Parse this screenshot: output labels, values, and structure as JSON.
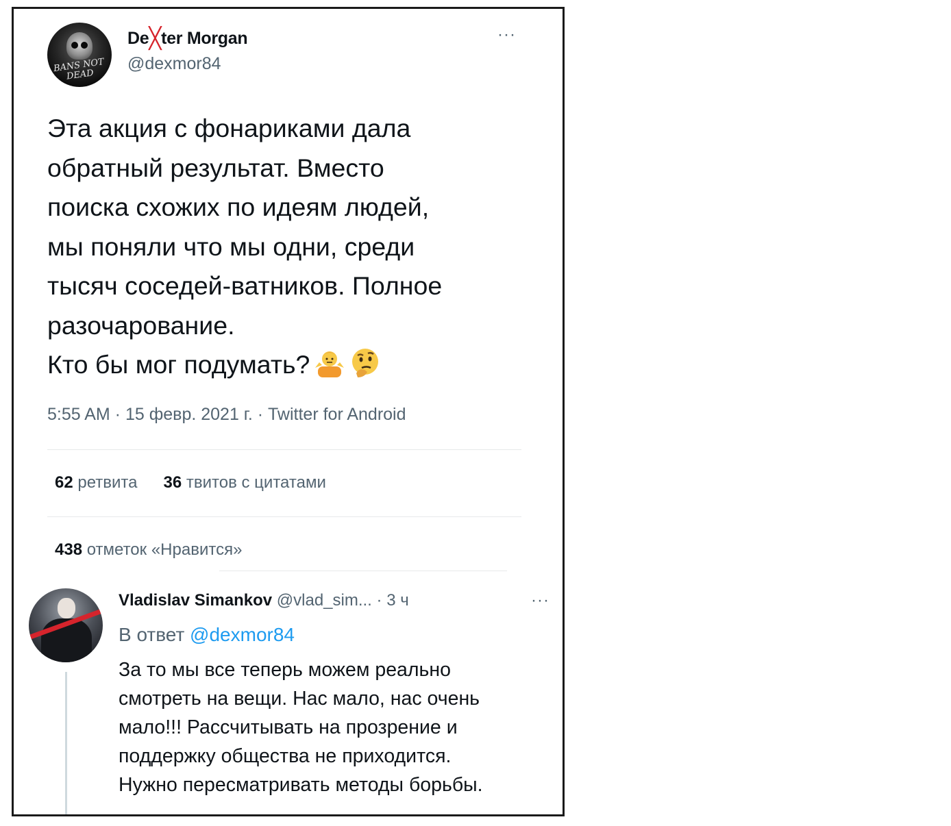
{
  "tweet": {
    "author_name_pre": "De",
    "author_name_x": "╳",
    "author_name_post": "ter Morgan",
    "author_handle": "@dexmor84",
    "more_label": "···",
    "avatar_text": "BANS NOT DEAD",
    "text": "Эта акция с фонариками дала\nобратный результат. Вместо\nпоиска схожих по идеям людей,\nмы поняли что мы одни, среди\nтысяч соседей-ватников. Полное\nразочарование.\nКто бы мог подумать?",
    "emojis": [
      "shrug-emoji",
      "thinking-face-emoji"
    ],
    "meta": "5:55 AM · 15 февр. 2021 г. · Twitter for Android",
    "retweets_count": "62",
    "retweets_label": "ретвита",
    "quotes_count": "36",
    "quotes_label": "твитов с цитатами",
    "likes_count": "438",
    "likes_label": "отметок «Нравится»"
  },
  "reply": {
    "author_name": "Vladislav Simankov",
    "author_handle": "@vlad_sim...",
    "time": " · 3 ч",
    "more_label": "···",
    "reply_to_prefix": "В ответ ",
    "reply_to_mention": "@dexmor84",
    "text": "За то мы все теперь можем реально\nсмотреть на вещи. Нас мало, нас очень\nмало!!! Рассчитывать на прозрение и\nподдержку общества не приходится.\nНужно пересматривать методы борьбы."
  },
  "colors": {
    "text_primary": "#0f1419",
    "text_secondary": "#536471",
    "link": "#1d9bf0",
    "name_x_accent": "#d6242c",
    "divider": "#e7e9ea"
  }
}
